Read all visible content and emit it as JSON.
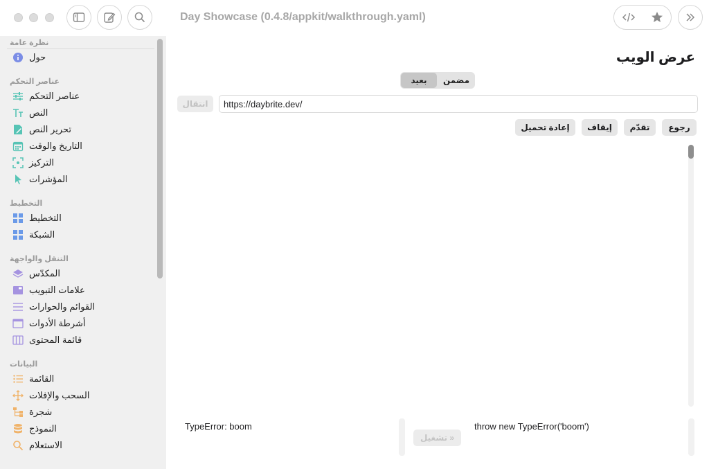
{
  "window": {
    "title": "Day Showcase (0.4.8/appkit/walkthrough.yaml)"
  },
  "toolbar": {
    "buttons": [
      "sidebar-toggle-icon",
      "compose-icon",
      "search-icon"
    ],
    "right_buttons": [
      "code-icon",
      "star-icon",
      "chevron-double-right-icon"
    ]
  },
  "sidebar": {
    "sections": [
      {
        "title": "نظرة عامة",
        "items": [
          {
            "label": "حول",
            "icon": "info-icon",
            "color": "#7b8de6"
          }
        ]
      },
      {
        "title": "عناصر التحكم",
        "items": [
          {
            "label": "عناصر التحكم",
            "icon": "sliders-icon",
            "color": "#57c4b5"
          },
          {
            "label": "النص",
            "icon": "text-icon",
            "color": "#57c4b5"
          },
          {
            "label": "تحرير النص",
            "icon": "edit-document-icon",
            "color": "#57c4b5"
          },
          {
            "label": "التاريخ والوقت",
            "icon": "calendar-icon",
            "color": "#57c4b5"
          },
          {
            "label": "التركيز",
            "icon": "focus-icon",
            "color": "#57c4b5"
          },
          {
            "label": "المؤشرات",
            "icon": "cursor-icon",
            "color": "#57c4b5"
          }
        ]
      },
      {
        "title": "التخطيط",
        "items": [
          {
            "label": "التخطيط",
            "icon": "layout-grid-icon",
            "color": "#6b9ae8"
          },
          {
            "label": "الشبكة",
            "icon": "grid-icon",
            "color": "#6b9ae8"
          }
        ]
      },
      {
        "title": "التنقل والواجهة",
        "items": [
          {
            "label": "المكدّس",
            "icon": "stack-icon",
            "color": "#a593e0"
          },
          {
            "label": "علامات التبويب",
            "icon": "tabs-icon",
            "color": "#a593e0"
          },
          {
            "label": "القوائم والحوارات",
            "icon": "menu-lines-icon",
            "color": "#a593e0"
          },
          {
            "label": "أشرطة الأدوات",
            "icon": "toolbar-window-icon",
            "color": "#a593e0"
          },
          {
            "label": "قائمة المحتوى",
            "icon": "columns-icon",
            "color": "#a593e0"
          }
        ]
      },
      {
        "title": "البيانات",
        "items": [
          {
            "label": "القائمة",
            "icon": "list-icon",
            "color": "#f0b36a"
          },
          {
            "label": "السحب والإفلات",
            "icon": "move-arrows-icon",
            "color": "#f0b36a"
          },
          {
            "label": "شجرة",
            "icon": "tree-icon",
            "color": "#f0b36a"
          },
          {
            "label": "النموذج",
            "icon": "database-icon",
            "color": "#f0b36a"
          },
          {
            "label": "الاستعلام",
            "icon": "magnifier-icon",
            "color": "#f0b36a"
          }
        ]
      }
    ]
  },
  "main": {
    "title": "عرض الويب",
    "segments": [
      "بعيد",
      "مضمن"
    ],
    "selected_segment": "بعيد",
    "go_label": "انتقال",
    "url_value": "https://daybrite.dev/",
    "nav_buttons": {
      "back": "رجوع",
      "forward": "تقدّم",
      "stop": "إيقاف",
      "reload": "إعادة تحميل"
    },
    "result_text": "TypeError: boom",
    "run_label": "تشغيل »",
    "code_text": "throw new TypeError('boom')"
  }
}
